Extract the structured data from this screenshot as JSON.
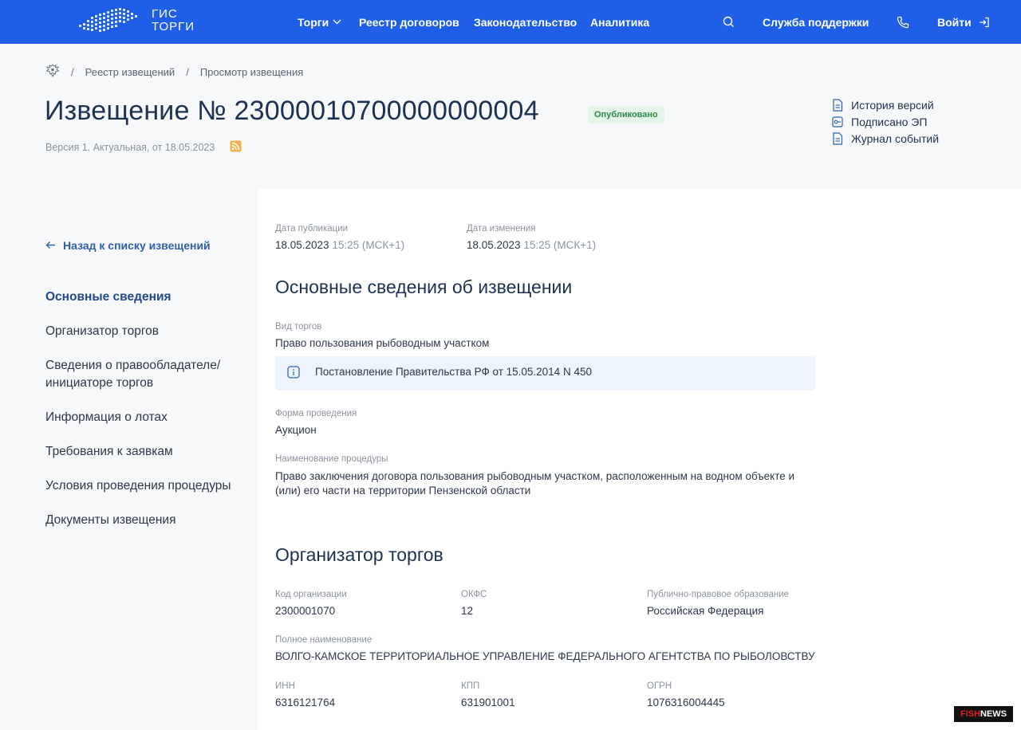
{
  "header": {
    "logo_line1": "ГИС",
    "logo_line2": "ТОРГИ",
    "nav": [
      {
        "label": "Торги"
      },
      {
        "label": "Реестр договоров"
      },
      {
        "label": "Законодательство"
      },
      {
        "label": "Аналитика"
      }
    ],
    "support_label": "Служба поддержки",
    "login_label": "Войти",
    "icons": {
      "search": "search-icon",
      "phone": "phone-icon",
      "login": "login-icon",
      "dropdown": "chevron-down-icon"
    },
    "bg_color": "#1f5ee6"
  },
  "breadcrumb": {
    "home_icon": "emblem-icon",
    "items": [
      "Реестр извещений",
      "Просмотр извещения"
    ]
  },
  "notice": {
    "title": "Извещение № 23000010700000000004",
    "status": "Опубликовано",
    "version_line": "Версия 1. Актуальная, от 18.05.2023"
  },
  "side_links": [
    {
      "label": "История версий",
      "icon": "document-icon"
    },
    {
      "label": "Подписано ЭП",
      "icon": "key-icon"
    },
    {
      "label": "Журнал событий",
      "icon": "document-icon"
    }
  ],
  "sidebar": {
    "back_label": "Назад к списку извещений",
    "items": [
      {
        "label": "Основные сведения",
        "active": true
      },
      {
        "label": "Организатор торгов"
      },
      {
        "label": "Сведения о правообладателе/ инициаторе торгов"
      },
      {
        "label": "Информация о лотах"
      },
      {
        "label": "Требования к заявкам"
      },
      {
        "label": "Условия проведения процедуры"
      },
      {
        "label": "Документы извещения"
      }
    ]
  },
  "dates": {
    "published_label": "Дата публикации",
    "published_date": "18.05.2023",
    "published_time": "15:25 (МСК+1)",
    "modified_label": "Дата изменения",
    "modified_date": "18.05.2023",
    "modified_time": "15:25 (МСК+1)"
  },
  "basic_info": {
    "title": "Основные сведения об извещении",
    "trade_type_label": "Вид торгов",
    "trade_type_value": "Право пользования рыбоводным участком",
    "info_note": "Постановление Правительства РФ от 15.05.2014 N 450",
    "form_label": "Форма проведения",
    "form_value": "Аукцион",
    "procedure_label": "Наименование процедуры",
    "procedure_value": "Право заключения договора пользования рыбоводным участком, расположенным на водном объекте и (или) его части на территории Пензенской области"
  },
  "organizer": {
    "title": "Организатор торгов",
    "org_code_label": "Код организации",
    "org_code_value": "2300001070",
    "okfs_label": "ОКФС",
    "okfs_value": "12",
    "ppo_label": "Публично-правовое образование",
    "ppo_value": "Российская Федерация",
    "full_name_label": "Полное наименование",
    "full_name_value": "ВОЛГО-КАМСКОЕ ТЕРРИТОРИАЛЬНОЕ УПРАВЛЕНИЕ ФЕДЕРАЛЬНОГО АГЕНТСТВА ПО РЫБОЛОВСТВУ",
    "inn_label": "ИНН",
    "inn_value": "6316121764",
    "kpp_label": "КПП",
    "kpp_value": "631901001",
    "ogrn_label": "ОГРН",
    "ogrn_value": "1076316004445"
  },
  "watermark": {
    "part1": "FISH",
    "part2": "NEWS"
  }
}
